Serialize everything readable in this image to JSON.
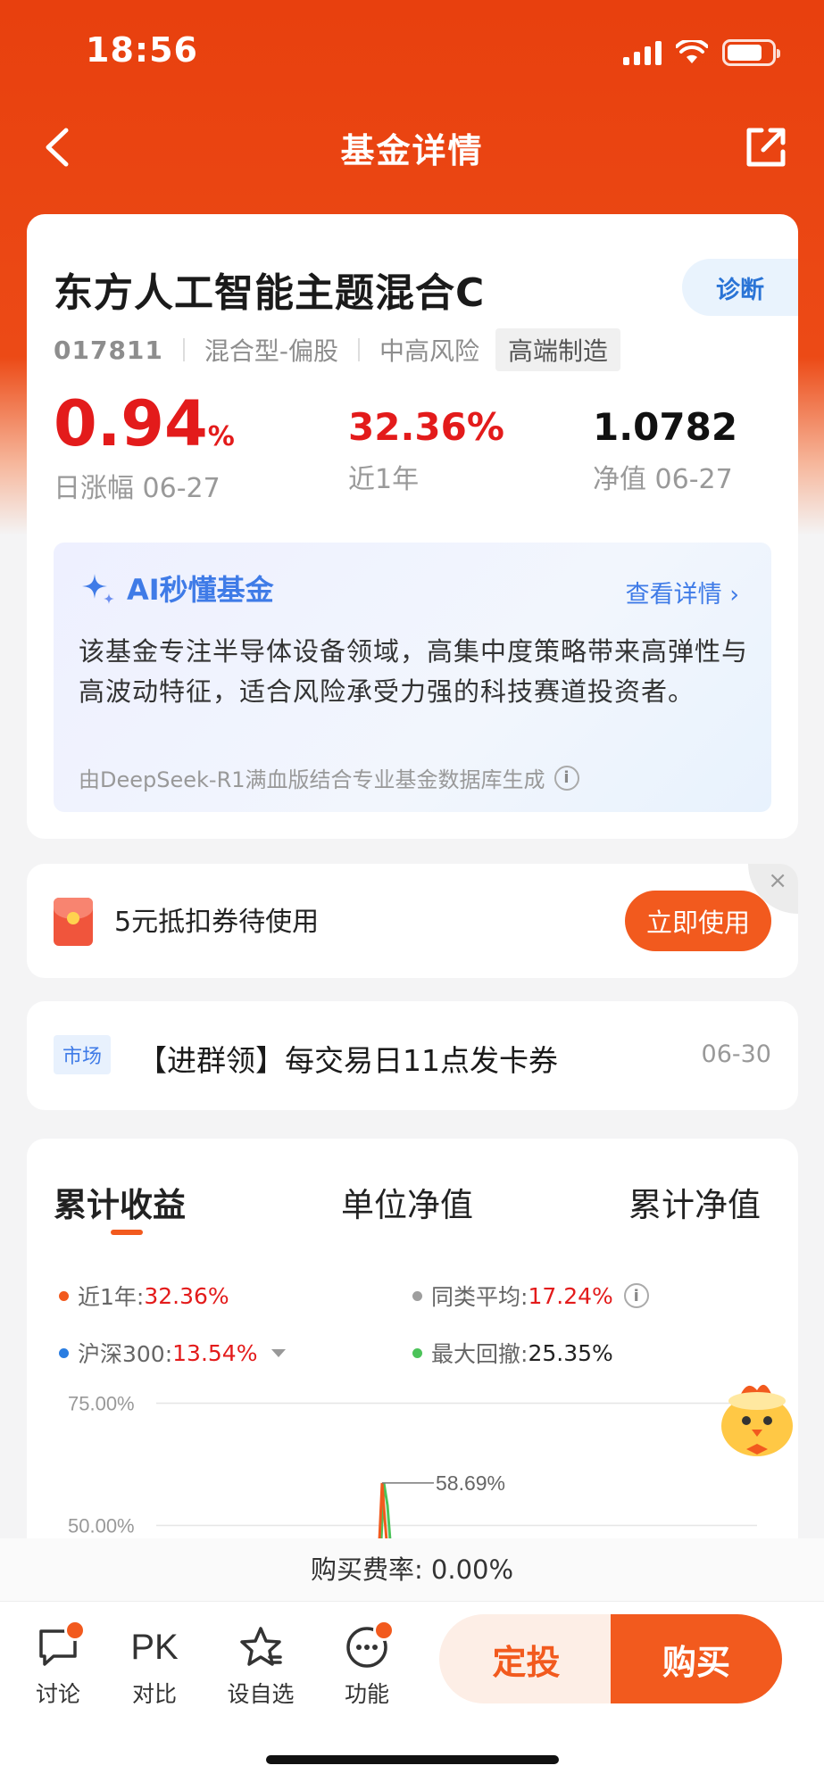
{
  "status": {
    "time": "18:56"
  },
  "nav": {
    "title": "基金详情"
  },
  "fund": {
    "name": "东方人工智能主题混合C",
    "diagnose_label": "诊断",
    "code": "017811",
    "type": "混合型-偏股",
    "risk": "中高风险",
    "theme_tag": "高端制造",
    "daily_change_value": "0.94",
    "daily_change_unit": "%",
    "daily_change_label": "日涨幅 06-27",
    "year_return_value": "32.36%",
    "year_return_label": "近1年",
    "nav_value": "1.0782",
    "nav_label": "净值 06-27"
  },
  "ai": {
    "title": "AI秒懂基金",
    "detail_link": "查看详情 ›",
    "summary": "该基金专注半导体设备领域，高集中度策略带来高弹性与高波动特征，适合风险承受力强的科技赛道投资者。",
    "source_note": "由DeepSeek-R1满血版结合专业基金数据库生成"
  },
  "coupon": {
    "text": "5元抵扣券待使用",
    "button_label": "立即使用",
    "close": "×"
  },
  "notice": {
    "tag": "市场",
    "text": "【进群领】每交易日11点发卡券",
    "date": "06-30"
  },
  "chart_tabs": [
    "累计收益",
    "单位净值",
    "累计净值"
  ],
  "legend": {
    "one_year_label": "近1年:",
    "one_year_value": "32.36%",
    "peer_avg_label": "同类平均:",
    "peer_avg_value": "17.24%",
    "hs300_label": "沪深300:",
    "hs300_value": "13.54%",
    "max_drawdown_label": "最大回撤:",
    "max_drawdown_value": "25.35%"
  },
  "chart_data": {
    "type": "line",
    "y_ticks": [
      "75.00%",
      "50.00%"
    ],
    "y_tick_values": [
      75,
      50
    ],
    "annotation": "58.69%",
    "peak_value": 58.69,
    "visible_ylim": [
      47,
      78
    ],
    "colors": {
      "fund": "#f25a1e",
      "peer": "#9e9e9e",
      "hs300": "#2a7de1",
      "drawdown": "#4cc35a"
    }
  },
  "bottom": {
    "fee_label": "购买费率: 0.00%",
    "items": [
      {
        "label": "讨论",
        "icon": "chat-bubble-icon"
      },
      {
        "label": "对比",
        "icon": "PK"
      },
      {
        "label": "设自选",
        "icon": "star-icon"
      },
      {
        "label": "功能",
        "icon": "more-dots-icon"
      }
    ],
    "dingtou_label": "定投",
    "buy_label": "购买"
  },
  "colors": {
    "brand": "#e8400e",
    "accent": "#f25a1e",
    "up": "#e31b1b",
    "ai_blue": "#3f7be7"
  }
}
